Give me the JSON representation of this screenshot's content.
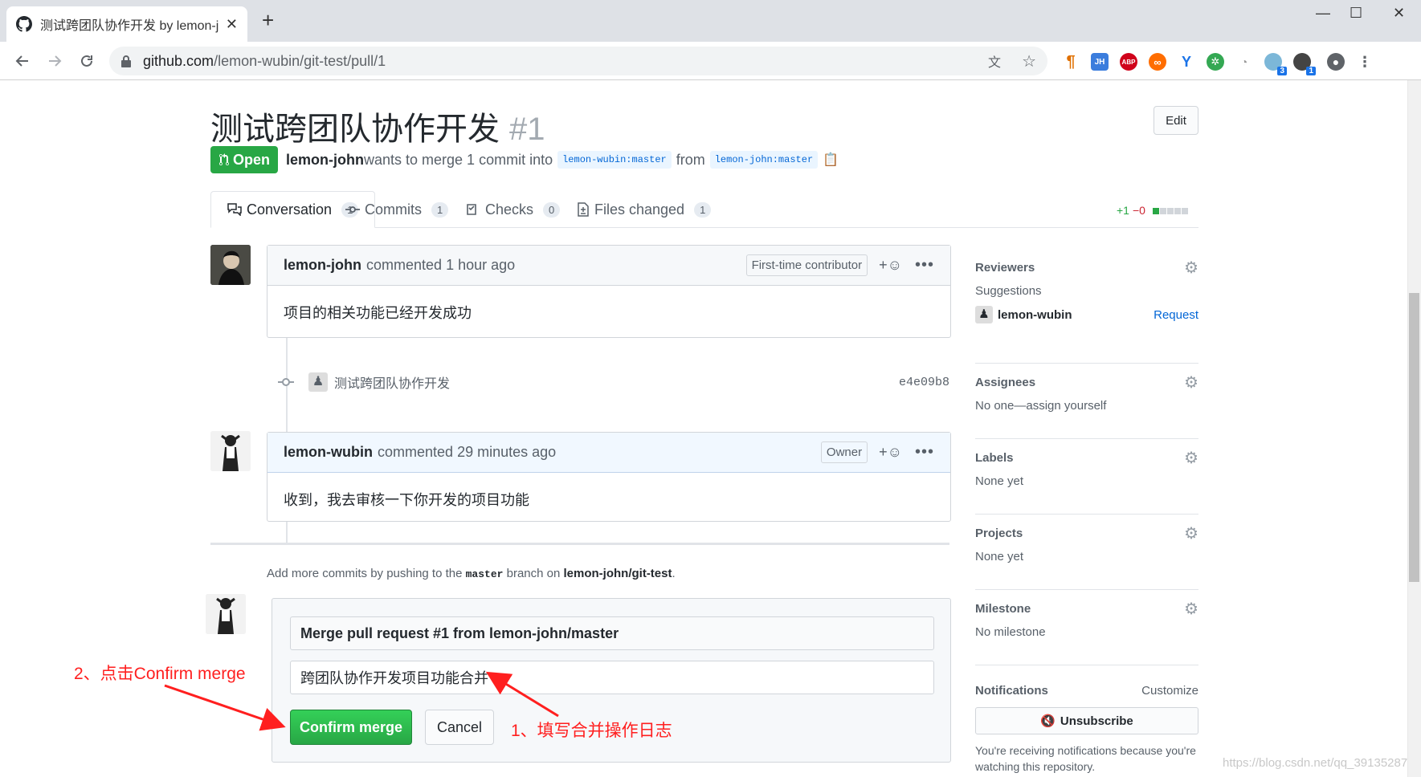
{
  "browser": {
    "tab_title": "测试跨团队协作开发 by lemon-j",
    "url_host": "github.com",
    "url_path": "/lemon-wubin/git-test/pull/1",
    "ext_badges": [
      "3",
      "1"
    ]
  },
  "pr": {
    "title": "测试跨团队协作开发",
    "number": "#1",
    "edit_label": "Edit",
    "state": "Open",
    "author": "lemon-john",
    "meta_mid": "wants to merge 1 commit into",
    "base_branch": "lemon-wubin:master",
    "meta_from": "from",
    "head_branch": "lemon-john:master",
    "tabs": [
      {
        "label": "Conversation",
        "count": "1"
      },
      {
        "label": "Commits",
        "count": "1"
      },
      {
        "label": "Checks",
        "count": "0"
      },
      {
        "label": "Files changed",
        "count": "1"
      }
    ],
    "diff_add": "+1",
    "diff_del": "−0"
  },
  "timeline": {
    "comment1": {
      "author": "lemon-john",
      "action": "commented",
      "time": "1 hour ago",
      "badge": "First-time contributor",
      "body": "项目的相关功能已经开发成功"
    },
    "commit": {
      "message": "测试跨团队协作开发",
      "sha": "e4e09b8"
    },
    "comment2": {
      "author": "lemon-wubin",
      "action": "commented",
      "time": "29 minutes ago",
      "badge": "Owner",
      "body": "收到，我去审核一下你开发的项目功能"
    },
    "add_more_prefix": "Add more commits by pushing to the",
    "add_more_branch": "master",
    "add_more_mid": "branch on",
    "add_more_repo": "lemon-john/git-test",
    "add_more_suffix": "."
  },
  "merge": {
    "title_value": "Merge pull request #1 from lemon-john/master",
    "message_value": "跨团队协作开发项目功能合并",
    "confirm_label": "Confirm merge",
    "cancel_label": "Cancel"
  },
  "sidebar": {
    "reviewers": "Reviewers",
    "suggestions": "Suggestions",
    "suggested_user": "lemon-wubin",
    "request": "Request",
    "assignees": "Assignees",
    "assignees_value": "No one—assign yourself",
    "labels": "Labels",
    "labels_value": "None yet",
    "projects": "Projects",
    "projects_value": "None yet",
    "milestone": "Milestone",
    "milestone_value": "No milestone",
    "notifications": "Notifications",
    "customize": "Customize",
    "unsubscribe": "Unsubscribe",
    "notif_note": "You're receiving notifications because you're watching this repository."
  },
  "annotations": {
    "step2": "2、点击Confirm merge",
    "step1": "1、填写合并操作日志"
  },
  "watermark": "https://blog.csdn.net/qq_39135287",
  "colors": {
    "open_green": "#28a745",
    "link_blue": "#0366d6",
    "annotation_red": "#ff1f1f"
  }
}
